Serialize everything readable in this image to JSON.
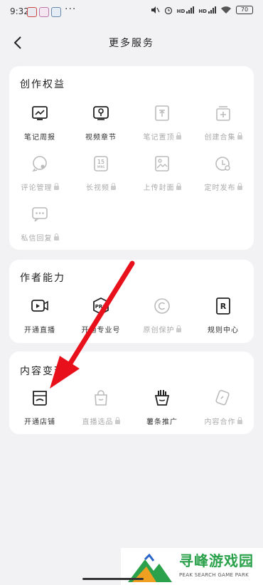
{
  "status": {
    "time": "9:32",
    "dots": "···",
    "hd1": "HD",
    "hd2": "HD",
    "battery": "70"
  },
  "header": {
    "title": "更多服务"
  },
  "sections": [
    {
      "title": "创作权益",
      "items": [
        {
          "label": "笔记周报",
          "icon": "report-icon",
          "locked": false
        },
        {
          "label": "视频章节",
          "icon": "video-chapter-icon",
          "locked": false
        },
        {
          "label": "笔记置顶",
          "icon": "pin-top-icon",
          "locked": true
        },
        {
          "label": "创建合集",
          "icon": "collection-icon",
          "locked": true
        },
        {
          "label": "评论管理",
          "icon": "comment-icon",
          "locked": true
        },
        {
          "label": "长视频",
          "icon": "long-video-icon",
          "locked": true
        },
        {
          "label": "上传封面",
          "icon": "cover-icon",
          "locked": true
        },
        {
          "label": "定时发布",
          "icon": "clock-icon",
          "locked": true
        },
        {
          "label": "私信回复",
          "icon": "message-icon",
          "locked": true
        }
      ]
    },
    {
      "title": "作者能力",
      "items": [
        {
          "label": "开通直播",
          "icon": "live-icon",
          "locked": false
        },
        {
          "label": "开通专业号",
          "icon": "pro-badge-icon",
          "locked": false
        },
        {
          "label": "原创保护",
          "icon": "copyright-icon",
          "locked": true
        },
        {
          "label": "规则中心",
          "icon": "rules-icon",
          "locked": false
        }
      ]
    },
    {
      "title": "内容变现",
      "items": [
        {
          "label": "开通店铺",
          "icon": "shop-icon",
          "locked": false
        },
        {
          "label": "直播选品",
          "icon": "bag-icon",
          "locked": true
        },
        {
          "label": "薯条推广",
          "icon": "fries-icon",
          "locked": false
        },
        {
          "label": "内容合作",
          "icon": "cooperation-icon",
          "locked": true
        }
      ]
    }
  ],
  "watermark": {
    "title": "寻峰游戏园",
    "subtitle": "PEAK SEARCH GAME PARK"
  },
  "colors": {
    "background": "#f2f2f4",
    "card": "#ffffff",
    "arrow": "#e8101a",
    "text": "#222222",
    "disabled": "#aaaaaa",
    "watermark": "#2aa14a"
  }
}
